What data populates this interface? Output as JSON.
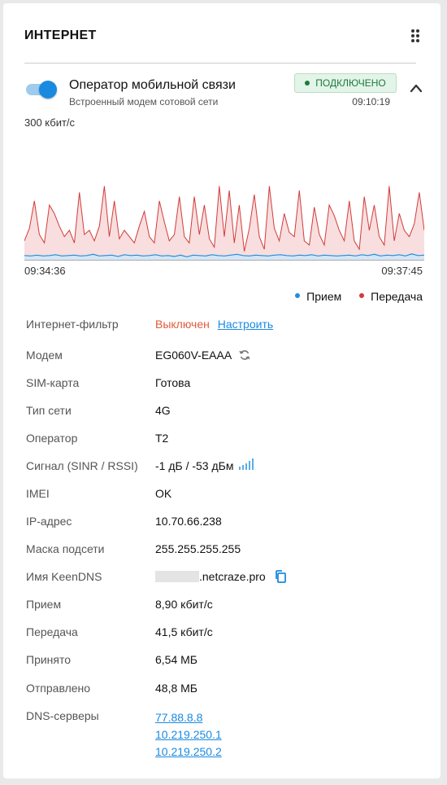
{
  "header": {
    "title": "ИНТЕРНЕТ"
  },
  "interface": {
    "name": "Оператор мобильной связи",
    "subtitle": "Встроенный модем сотовой сети",
    "status": "ПОДКЛЮЧЕНО",
    "uptime": "09:10:19",
    "enabled": true
  },
  "colors": {
    "accent": "#1a8ae0",
    "receive": "#1f8fdc",
    "transmit": "#d23b3b",
    "status_ok": "#1e7a3d",
    "warn": "#e05c3c"
  },
  "chart_data": {
    "type": "area",
    "y_max_label": "300 кбит/с",
    "ylim": [
      0,
      300
    ],
    "x_start": "09:34:36",
    "x_end": "09:37:45",
    "legend_position": "bottom-right",
    "series": [
      {
        "name": "Прием",
        "color": "#1f8fdc",
        "values": [
          10,
          9,
          11,
          9,
          10,
          12,
          9,
          10,
          11,
          9,
          10,
          13,
          9,
          10,
          11,
          8,
          12,
          10,
          11,
          9,
          10,
          12,
          9,
          10,
          8,
          11,
          7,
          11,
          10,
          9,
          12,
          10,
          9,
          11,
          13,
          10,
          9,
          11,
          10,
          9,
          11,
          12,
          10,
          9,
          11,
          10,
          12,
          9,
          11,
          10,
          9,
          10,
          11,
          9,
          12,
          10,
          13,
          9,
          11,
          10,
          12,
          9,
          14,
          10,
          11
        ]
      },
      {
        "name": "Передача",
        "color": "#d23b3b",
        "values": [
          45,
          75,
          140,
          60,
          40,
          130,
          110,
          80,
          55,
          70,
          40,
          160,
          60,
          70,
          45,
          80,
          175,
          55,
          140,
          50,
          70,
          55,
          40,
          80,
          115,
          55,
          40,
          140,
          90,
          45,
          60,
          150,
          55,
          40,
          150,
          60,
          130,
          50,
          30,
          175,
          55,
          165,
          40,
          130,
          20,
          75,
          155,
          55,
          25,
          175,
          75,
          45,
          110,
          65,
          55,
          165,
          45,
          35,
          125,
          60,
          35,
          130,
          105,
          70,
          45,
          140,
          45,
          25,
          150,
          70,
          130,
          55,
          35,
          175,
          45,
          110,
          70,
          55,
          85,
          160,
          70
        ]
      }
    ]
  },
  "legend": {
    "receive": "Прием",
    "transmit": "Передача"
  },
  "details": {
    "filter": {
      "label": "Интернет-фильтр",
      "value": "Выключен",
      "action": "Настроить"
    },
    "modem": {
      "label": "Модем",
      "value": "EG060V-EAAA",
      "icon": "refresh-icon"
    },
    "sim": {
      "label": "SIM-карта",
      "value": "Готова"
    },
    "net_type": {
      "label": "Тип сети",
      "value": "4G"
    },
    "operator": {
      "label": "Оператор",
      "value": "T2"
    },
    "signal": {
      "label": "Сигнал (SINR / RSSI)",
      "value": "-1 дБ / -53 дБм",
      "icon": "signal-bars-icon"
    },
    "imei": {
      "label": "IMEI",
      "value": "OK"
    },
    "ip": {
      "label": "IP-адрес",
      "value": "10.70.66.238"
    },
    "mask": {
      "label": "Маска подсети",
      "value": "255.255.255.255"
    },
    "keendns": {
      "label": "Имя KeenDNS",
      "value": ".netcraze.pro",
      "icon": "copy-icon"
    },
    "rx_rate": {
      "label": "Прием",
      "value": "8,90 кбит/с"
    },
    "tx_rate": {
      "label": "Передача",
      "value": "41,5 кбит/с"
    },
    "received": {
      "label": "Принято",
      "value": "6,54 МБ"
    },
    "sent": {
      "label": "Отправлено",
      "value": "48,8 МБ"
    },
    "dns": {
      "label": "DNS-серверы",
      "servers": [
        "77.88.8.8",
        "10.219.250.1",
        "10.219.250.2"
      ]
    }
  }
}
